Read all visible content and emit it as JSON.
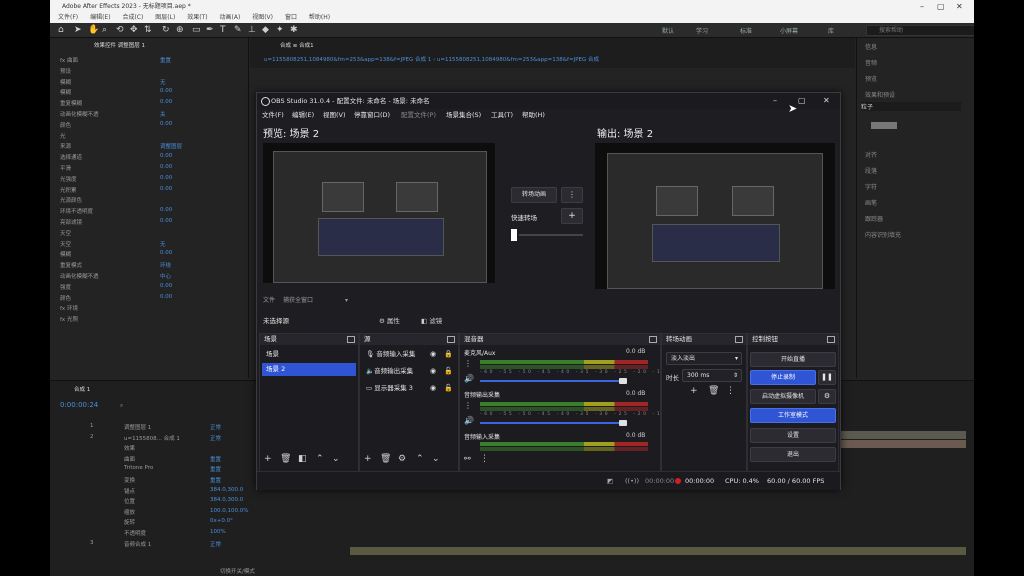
{
  "ae": {
    "title": "Adobe After Effects 2023 - 无标题项目.aep *",
    "menu": [
      "文件(F)",
      "编辑(E)",
      "合成(C)",
      "图层(L)",
      "效果(T)",
      "动画(A)",
      "视图(V)",
      "窗口",
      "帮助(H)"
    ],
    "workspaces": [
      "默认",
      "学习",
      "标准",
      "小屏幕",
      "库"
    ],
    "search_placeholder": "搜索帮助",
    "left_tab": "效果控件 调整图层 1",
    "comp_tab": "合成 ≡ 合成1",
    "comp_path": "u=1155808251,1084980&fm=253&app=138&f=JPEG 合成 1 ‹ u=1155808251,1084980&fm=253&app=138&f=JPEG 合成",
    "props": [
      {
        "label": "fx 曲面",
        "value": "重置"
      },
      {
        "label": "预设",
        "value": ""
      },
      {
        "label": "模糊",
        "value": "无"
      },
      {
        "label": "模糊",
        "value": "0.00"
      },
      {
        "label": "重复模糊",
        "value": "0.00"
      },
      {
        "label": "动画化模糊不透",
        "value": "关"
      },
      {
        "label": "颜色",
        "value": "0.00"
      },
      {
        "label": "光",
        "value": ""
      },
      {
        "label": "来源",
        "value": "调整图层"
      },
      {
        "label": "选择通道",
        "value": "0.00"
      },
      {
        "label": "平滑",
        "value": "0.00"
      },
      {
        "label": "光强度",
        "value": "0.00"
      },
      {
        "label": "光积累",
        "value": "0.00"
      },
      {
        "label": "光源颜色",
        "value": ""
      },
      {
        "label": "环境不透明度",
        "value": "0.00"
      },
      {
        "label": "亮部滤镜",
        "value": "0.00"
      },
      {
        "label": "天空",
        "value": ""
      },
      {
        "label": "天空",
        "value": "无"
      },
      {
        "label": "模糊",
        "value": "0.00"
      },
      {
        "label": "重复模式",
        "value": "环绕"
      },
      {
        "label": "动画化模糊不透",
        "value": "中心"
      },
      {
        "label": "强度",
        "value": "0.00"
      },
      {
        "label": "颜色",
        "value": "0.00"
      },
      {
        "label": "fx 环境",
        "value": ""
      },
      {
        "label": "fx 光照",
        "value": ""
      }
    ],
    "right_panel": [
      "信息",
      "音频",
      "预览",
      "效果和预设",
      "对齐",
      "段落",
      "字符",
      "画笔",
      "跟踪器",
      "内容识别填充"
    ],
    "right_search": "粒子",
    "timeline_tab": "合成 1",
    "timecode": "0:00:00:24",
    "timeline_rows": [
      {
        "num": "1",
        "name": "调整图层 1",
        "mode": "正常"
      },
      {
        "num": "2",
        "name": "u=1155808... 合成 1",
        "mode": "正常"
      },
      {
        "num": "",
        "name": "效果",
        "mode": ""
      },
      {
        "num": "",
        "name": "曲面",
        "mode": "重置"
      },
      {
        "num": "",
        "name": "Tritone Pro",
        "mode": "重置"
      },
      {
        "num": "",
        "name": "变换",
        "mode": "重置"
      },
      {
        "num": "",
        "name": "锚点",
        "mode": "384.0,300.0"
      },
      {
        "num": "",
        "name": "位置",
        "mode": "384.0,300.0"
      },
      {
        "num": "",
        "name": "缩放",
        "mode": "100.0,100.0%"
      },
      {
        "num": "",
        "name": "旋转",
        "mode": "0x+0.0°"
      },
      {
        "num": "",
        "name": "不透明度",
        "mode": "100%"
      },
      {
        "num": "3",
        "name": "音频合成 1",
        "mode": "正常"
      }
    ],
    "timeline_footer": "切换开关/模式"
  },
  "obs": {
    "title": "OBS Studio 31.0.4 - 配置文件: 未命名 - 场景: 未命名",
    "menu": [
      "文件(F)",
      "编辑(E)",
      "视图(V)",
      "停靠窗口(D)",
      "配置文件(P)",
      "场景集合(S)",
      "工具(T)",
      "帮助(H)"
    ],
    "preview_label": "预览: 场景 2",
    "program_label": "输出: 场景 2",
    "transition_button": "转场动画",
    "quick_transition": "快速转场",
    "file_label": "文件",
    "file_value": "捕获全窗口",
    "no_source_selected": "未选择源",
    "properties_button": "属性",
    "filters_button": "滤镜",
    "panels": {
      "scenes": {
        "title": "场景",
        "items": [
          "场景",
          "场景 2"
        ],
        "selected": 1
      },
      "sources": {
        "title": "源",
        "items": [
          "音频输入采集",
          "音频输出采集",
          "显示器采集 3"
        ]
      },
      "mixer": {
        "title": "混音器",
        "channels": [
          {
            "name": "麦克风/Aux",
            "db": "0.0 dB",
            "level": 0.85
          },
          {
            "name": "音频输出采集",
            "db": "0.0 dB",
            "level": 0.85
          },
          {
            "name": "音频输入采集",
            "db": "0.0 dB",
            "level": 0.85
          }
        ],
        "ticks": "-60 -55 -50 -45 -40 -35 -30 -25 -20 -15 -10 -5 0"
      },
      "transitions": {
        "title": "转场动画",
        "type": "淡入淡出",
        "duration_label": "时长",
        "duration_value": "300 ms"
      },
      "controls": {
        "title": "控制按钮",
        "start_stream": "开始直播",
        "stop_record": "停止录制",
        "virtual_camera": "启动虚拟摄像机",
        "studio_mode": "工作室模式",
        "settings": "设置",
        "exit": "退出"
      }
    },
    "status": {
      "stream_time": "00:00:00",
      "record_time": "00:00:00",
      "cpu": "CPU: 0.4%",
      "fps": "60.00 / 60.00 FPS"
    }
  },
  "colors": {
    "accent": "#2f55d4",
    "obs_bg": "#1e1e22",
    "ae_bg": "#232323",
    "value_blue": "#4a8fdc"
  }
}
